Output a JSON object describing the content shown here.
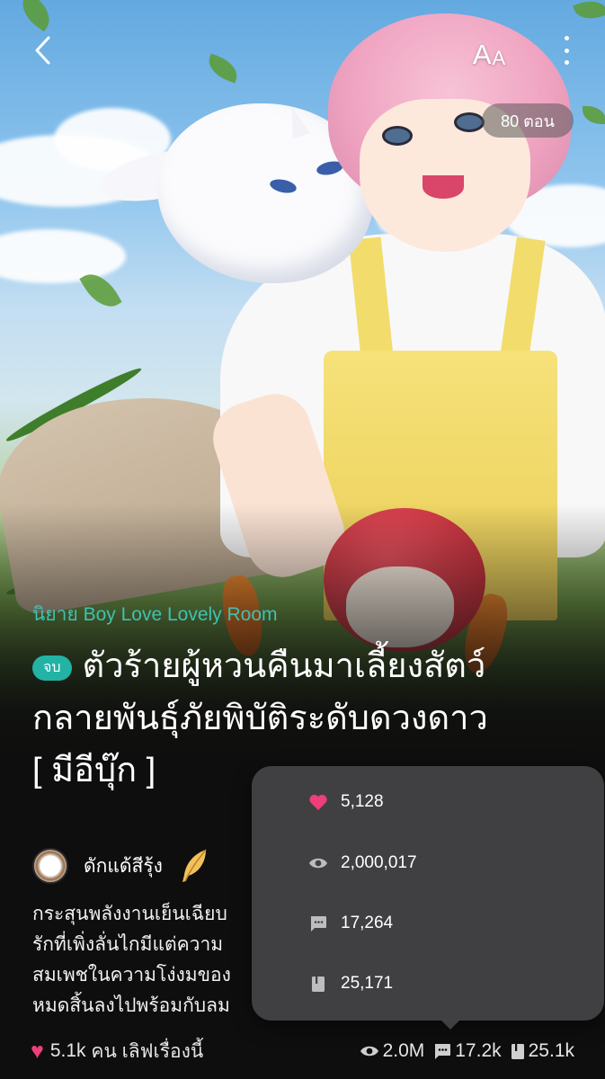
{
  "cover": {
    "episode_count": "80 ตอน"
  },
  "toolbar": {
    "font_size_big": "A",
    "font_size_small": "A"
  },
  "novel": {
    "category": "นิยาย Boy Love Lovely Room",
    "status_badge": "จบ",
    "title_lines": [
      "ตัวร้ายผู้หวนคืนมาเลี้ยงสัตว์",
      "กลายพันธุ์ภัยพิบัติระดับดวงดาว",
      "[ มีอีบุ๊ก ]"
    ],
    "author": "ดักแด้สีรุ้ง",
    "synopsis_lines": [
      "กระสุนพลังงานเย็นเฉียบ",
      "รักที่เพิ่งลั่นไกมีแต่ความ",
      "สมเพชในความโง่งมของ",
      "หมดสิ้นลงไปพร้อมกับลม"
    ]
  },
  "bottom_bar": {
    "love_count": "5.1k",
    "love_label": "คน เลิฟเรื่องนี้",
    "views": "2.0M",
    "comments": "17.2k",
    "reads": "25.1k"
  },
  "stats_popup": {
    "rows": [
      {
        "icon": "heart-icon",
        "value": "5,128"
      },
      {
        "icon": "eye-icon",
        "value": "2,000,017"
      },
      {
        "icon": "comment-icon",
        "value": "17,264"
      },
      {
        "icon": "book-icon",
        "value": "25,171"
      }
    ]
  },
  "colors": {
    "accent_teal": "#22b3a5",
    "category_teal": "#3fc1b2",
    "heart_pink": "#ee3f78",
    "background": "#0e0e0e",
    "popup_bg": "#424244"
  }
}
